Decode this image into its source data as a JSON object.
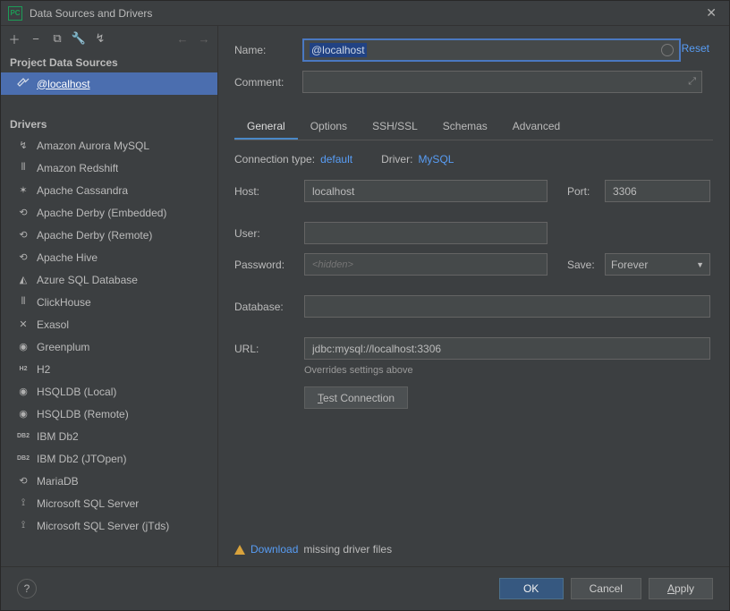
{
  "window": {
    "title": "Data Sources and Drivers",
    "app_badge": "PC"
  },
  "sidebar": {
    "project_header": "Project Data Sources",
    "data_sources": [
      {
        "label": "@localhost",
        "selected": true
      }
    ],
    "drivers_header": "Drivers",
    "drivers": [
      {
        "label": "Amazon Aurora MySQL"
      },
      {
        "label": "Amazon Redshift"
      },
      {
        "label": "Apache Cassandra"
      },
      {
        "label": "Apache Derby (Embedded)"
      },
      {
        "label": "Apache Derby (Remote)"
      },
      {
        "label": "Apache Hive"
      },
      {
        "label": "Azure SQL Database"
      },
      {
        "label": "ClickHouse"
      },
      {
        "label": "Exasol"
      },
      {
        "label": "Greenplum"
      },
      {
        "label": "H2"
      },
      {
        "label": "HSQLDB (Local)"
      },
      {
        "label": "HSQLDB (Remote)"
      },
      {
        "label": "IBM Db2"
      },
      {
        "label": "IBM Db2 (JTOpen)"
      },
      {
        "label": "MariaDB"
      },
      {
        "label": "Microsoft SQL Server"
      },
      {
        "label": "Microsoft SQL Server (jTds)"
      }
    ]
  },
  "form": {
    "name_label": "Name:",
    "name_value": "@localhost",
    "reset": "Reset",
    "comment_label": "Comment:",
    "tabs": [
      "General",
      "Options",
      "SSH/SSL",
      "Schemas",
      "Advanced"
    ],
    "active_tab": "General",
    "connection_type_label": "Connection type:",
    "connection_type_value": "default",
    "driver_label": "Driver:",
    "driver_value": "MySQL",
    "host_label": "Host:",
    "host_value": "localhost",
    "port_label": "Port:",
    "port_value": "3306",
    "user_label": "User:",
    "user_value": "",
    "password_label": "Password:",
    "password_placeholder": "<hidden>",
    "save_label": "Save:",
    "save_value": "Forever",
    "database_label": "Database:",
    "database_value": "",
    "url_label": "URL:",
    "url_value": "jdbc:mysql://localhost:3306",
    "url_note": "Overrides settings above",
    "test_connection": "Test Connection",
    "download_text1": "Download",
    "download_text2": "missing driver files"
  },
  "footer": {
    "ok": "OK",
    "cancel": "Cancel",
    "apply": "Apply"
  }
}
